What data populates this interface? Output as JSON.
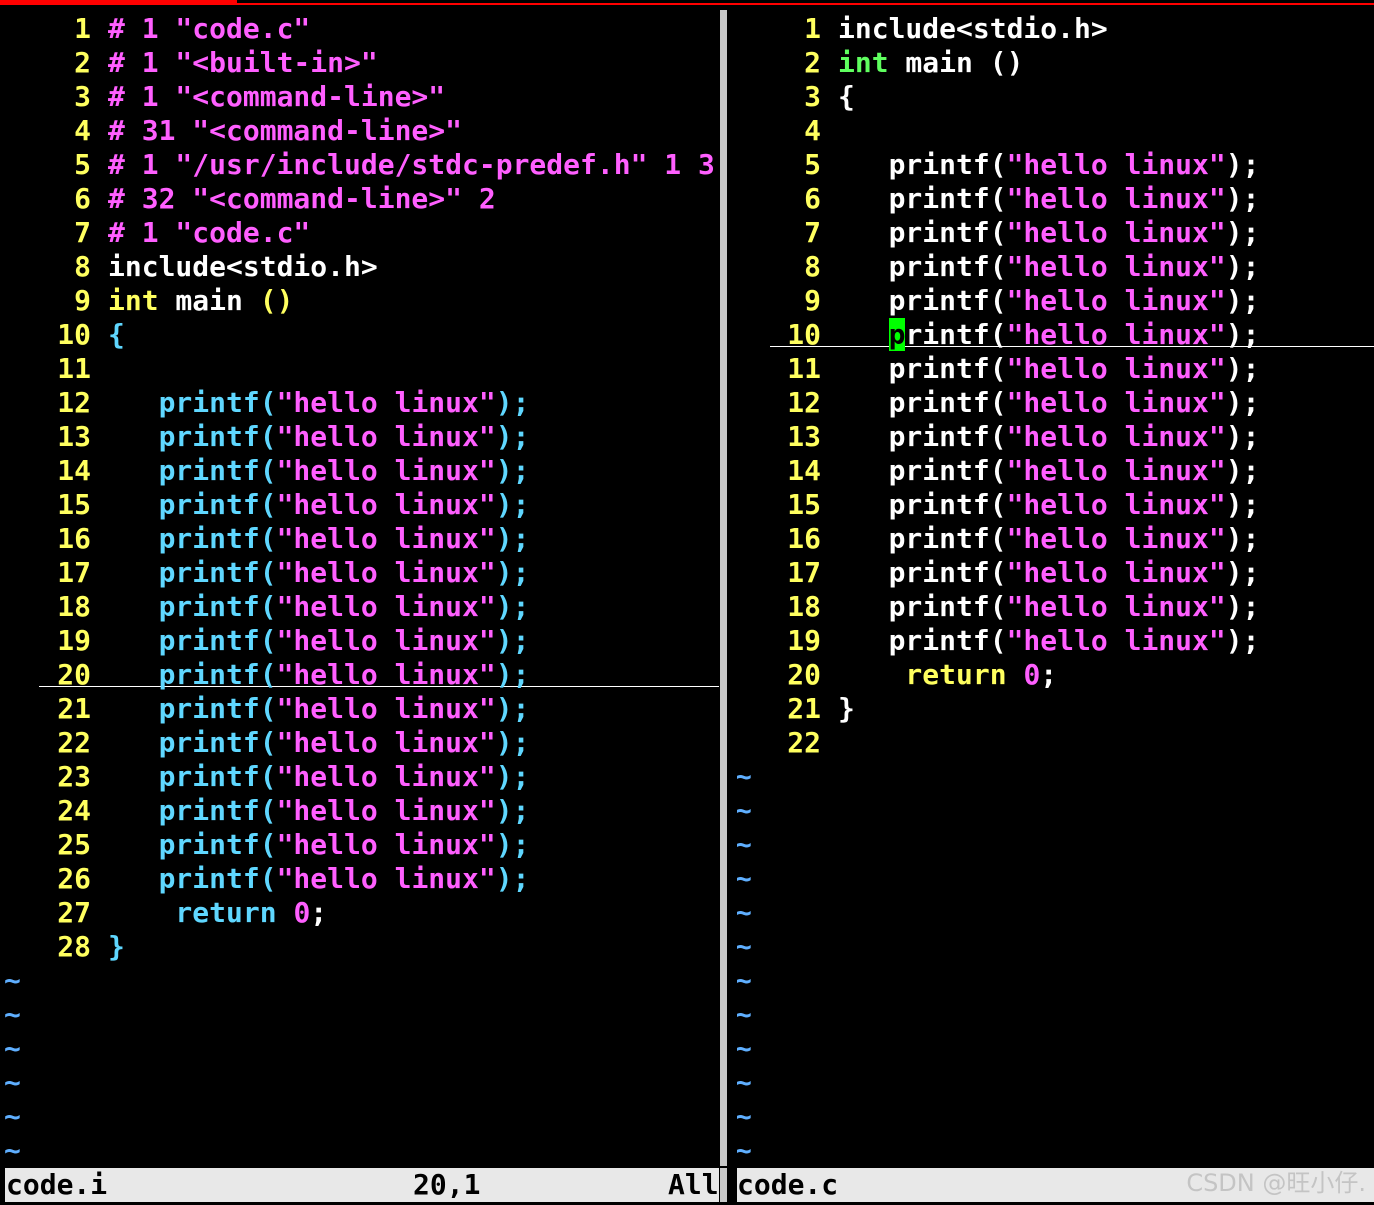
{
  "colors": {
    "background": "#000000",
    "line_number": "#ffff5f",
    "preproc": "#ff5fff",
    "string": "#ff5fff",
    "plain": "#ffffff",
    "left_code": "#5fd7ff",
    "left_keyword": "#ffff5f",
    "right_code": "#ffffff",
    "right_keyword": "#5fff5f",
    "return_right": "#ffff5f",
    "tilde": "#5fafff",
    "cursor": "#00ff00",
    "statusline": "#e8e8e8",
    "accent": "#ff0000"
  },
  "left_pane": {
    "lines": [
      {
        "num": "1",
        "segs": [
          [
            "# 1 \"code.c\"",
            "preproc"
          ]
        ]
      },
      {
        "num": "2",
        "segs": [
          [
            "# 1 \"<built-in>\"",
            "preproc"
          ]
        ]
      },
      {
        "num": "3",
        "segs": [
          [
            "# 1 \"<command-line>\"",
            "preproc"
          ]
        ]
      },
      {
        "num": "4",
        "segs": [
          [
            "# 31 \"<command-line>\"",
            "preproc"
          ]
        ]
      },
      {
        "num": "5",
        "segs": [
          [
            "# 1 \"/usr/include/stdc-predef.h\" 1 3",
            "preproc"
          ]
        ]
      },
      {
        "num": "6",
        "segs": [
          [
            "# 32 \"<command-line>\" 2",
            "preproc"
          ]
        ]
      },
      {
        "num": "7",
        "segs": [
          [
            "# 1 \"code.c\"",
            "preproc"
          ]
        ]
      },
      {
        "num": "8",
        "segs": [
          [
            "include<stdio.h>",
            "plain"
          ]
        ]
      },
      {
        "num": "9",
        "segs": [
          [
            "int",
            "left_keyword"
          ],
          [
            " main ",
            "plain"
          ],
          [
            "()",
            "left_keyword"
          ]
        ]
      },
      {
        "num": "10",
        "segs": [
          [
            "{",
            "left_code"
          ]
        ]
      },
      {
        "num": "11",
        "segs": []
      },
      {
        "num": "12",
        "segs": [
          [
            "   printf(",
            "left_code"
          ],
          [
            "\"hello linux\"",
            "string"
          ],
          [
            ");",
            "left_code"
          ]
        ]
      },
      {
        "num": "13",
        "segs": [
          [
            "   printf(",
            "left_code"
          ],
          [
            "\"hello linux\"",
            "string"
          ],
          [
            ");",
            "left_code"
          ]
        ]
      },
      {
        "num": "14",
        "segs": [
          [
            "   printf(",
            "left_code"
          ],
          [
            "\"hello linux\"",
            "string"
          ],
          [
            ");",
            "left_code"
          ]
        ]
      },
      {
        "num": "15",
        "segs": [
          [
            "   printf(",
            "left_code"
          ],
          [
            "\"hello linux\"",
            "string"
          ],
          [
            ");",
            "left_code"
          ]
        ]
      },
      {
        "num": "16",
        "segs": [
          [
            "   printf(",
            "left_code"
          ],
          [
            "\"hello linux\"",
            "string"
          ],
          [
            ");",
            "left_code"
          ]
        ]
      },
      {
        "num": "17",
        "segs": [
          [
            "   printf(",
            "left_code"
          ],
          [
            "\"hello linux\"",
            "string"
          ],
          [
            ");",
            "left_code"
          ]
        ]
      },
      {
        "num": "18",
        "segs": [
          [
            "   printf(",
            "left_code"
          ],
          [
            "\"hello linux\"",
            "string"
          ],
          [
            ");",
            "left_code"
          ]
        ]
      },
      {
        "num": "19",
        "segs": [
          [
            "   printf(",
            "left_code"
          ],
          [
            "\"hello linux\"",
            "string"
          ],
          [
            ");",
            "left_code"
          ]
        ]
      },
      {
        "num": "20",
        "segs": [
          [
            "   printf(",
            "left_code"
          ],
          [
            "\"hello linux\"",
            "string"
          ],
          [
            ");",
            "left_code"
          ]
        ]
      },
      {
        "num": "21",
        "segs": [
          [
            "   printf(",
            "left_code"
          ],
          [
            "\"hello linux\"",
            "string"
          ],
          [
            ");",
            "left_code"
          ]
        ]
      },
      {
        "num": "22",
        "segs": [
          [
            "   printf(",
            "left_code"
          ],
          [
            "\"hello linux\"",
            "string"
          ],
          [
            ");",
            "left_code"
          ]
        ]
      },
      {
        "num": "23",
        "segs": [
          [
            "   printf(",
            "left_code"
          ],
          [
            "\"hello linux\"",
            "string"
          ],
          [
            ");",
            "left_code"
          ]
        ]
      },
      {
        "num": "24",
        "segs": [
          [
            "   printf(",
            "left_code"
          ],
          [
            "\"hello linux\"",
            "string"
          ],
          [
            ");",
            "left_code"
          ]
        ]
      },
      {
        "num": "25",
        "segs": [
          [
            "   printf(",
            "left_code"
          ],
          [
            "\"hello linux\"",
            "string"
          ],
          [
            ");",
            "left_code"
          ]
        ]
      },
      {
        "num": "26",
        "segs": [
          [
            "   printf(",
            "left_code"
          ],
          [
            "\"hello linux\"",
            "string"
          ],
          [
            ");",
            "left_code"
          ]
        ]
      },
      {
        "num": "27",
        "segs": [
          [
            "    return ",
            "left_code"
          ],
          [
            "0",
            "string"
          ],
          [
            ";",
            "plain"
          ]
        ]
      },
      {
        "num": "28",
        "segs": [
          [
            "}",
            "left_code"
          ]
        ]
      }
    ],
    "tildes": [
      "~",
      "~",
      "~",
      "~",
      "~",
      "~"
    ]
  },
  "right_pane": {
    "lines": [
      {
        "num": "1",
        "segs": [
          [
            "include<stdio.h>",
            "plain"
          ]
        ]
      },
      {
        "num": "2",
        "segs": [
          [
            "int",
            "right_keyword"
          ],
          [
            " main ()",
            "plain"
          ]
        ]
      },
      {
        "num": "3",
        "segs": [
          [
            "{",
            "plain"
          ]
        ]
      },
      {
        "num": "4",
        "segs": []
      },
      {
        "num": "5",
        "segs": [
          [
            "   printf(",
            "right_code"
          ],
          [
            "\"hello linux\"",
            "string"
          ],
          [
            ");",
            "right_code"
          ]
        ]
      },
      {
        "num": "6",
        "segs": [
          [
            "   printf(",
            "right_code"
          ],
          [
            "\"hello linux\"",
            "string"
          ],
          [
            ");",
            "right_code"
          ]
        ]
      },
      {
        "num": "7",
        "segs": [
          [
            "   printf(",
            "right_code"
          ],
          [
            "\"hello linux\"",
            "string"
          ],
          [
            ");",
            "right_code"
          ]
        ]
      },
      {
        "num": "8",
        "segs": [
          [
            "   printf(",
            "right_code"
          ],
          [
            "\"hello linux\"",
            "string"
          ],
          [
            ");",
            "right_code"
          ]
        ]
      },
      {
        "num": "9",
        "segs": [
          [
            "   printf(",
            "right_code"
          ],
          [
            "\"hello linux\"",
            "string"
          ],
          [
            ");",
            "right_code"
          ]
        ]
      },
      {
        "num": "10",
        "segs": [
          [
            "   ",
            "right_code"
          ],
          [
            "p",
            "cursor"
          ],
          [
            "rintf(",
            "right_code"
          ],
          [
            "\"hello linux\"",
            "string"
          ],
          [
            ");",
            "right_code"
          ]
        ]
      },
      {
        "num": "11",
        "segs": [
          [
            "   printf(",
            "right_code"
          ],
          [
            "\"hello linux\"",
            "string"
          ],
          [
            ");",
            "right_code"
          ]
        ]
      },
      {
        "num": "12",
        "segs": [
          [
            "   printf(",
            "right_code"
          ],
          [
            "\"hello linux\"",
            "string"
          ],
          [
            ");",
            "right_code"
          ]
        ]
      },
      {
        "num": "13",
        "segs": [
          [
            "   printf(",
            "right_code"
          ],
          [
            "\"hello linux\"",
            "string"
          ],
          [
            ");",
            "right_code"
          ]
        ]
      },
      {
        "num": "14",
        "segs": [
          [
            "   printf(",
            "right_code"
          ],
          [
            "\"hello linux\"",
            "string"
          ],
          [
            ");",
            "right_code"
          ]
        ]
      },
      {
        "num": "15",
        "segs": [
          [
            "   printf(",
            "right_code"
          ],
          [
            "\"hello linux\"",
            "string"
          ],
          [
            ");",
            "right_code"
          ]
        ]
      },
      {
        "num": "16",
        "segs": [
          [
            "   printf(",
            "right_code"
          ],
          [
            "\"hello linux\"",
            "string"
          ],
          [
            ");",
            "right_code"
          ]
        ]
      },
      {
        "num": "17",
        "segs": [
          [
            "   printf(",
            "right_code"
          ],
          [
            "\"hello linux\"",
            "string"
          ],
          [
            ");",
            "right_code"
          ]
        ]
      },
      {
        "num": "18",
        "segs": [
          [
            "   printf(",
            "right_code"
          ],
          [
            "\"hello linux\"",
            "string"
          ],
          [
            ");",
            "right_code"
          ]
        ]
      },
      {
        "num": "19",
        "segs": [
          [
            "   printf(",
            "right_code"
          ],
          [
            "\"hello linux\"",
            "string"
          ],
          [
            ");",
            "right_code"
          ]
        ]
      },
      {
        "num": "20",
        "segs": [
          [
            "    return ",
            "return_right"
          ],
          [
            "0",
            "string"
          ],
          [
            ";",
            "plain"
          ]
        ]
      },
      {
        "num": "21",
        "segs": [
          [
            "}",
            "plain"
          ]
        ]
      },
      {
        "num": "22",
        "segs": []
      }
    ],
    "tildes": [
      "~",
      "~",
      "~",
      "~",
      "~",
      "~",
      "~",
      "~",
      "~",
      "~",
      "~",
      "~"
    ]
  },
  "status": {
    "left_filename": "code.i",
    "left_position": "20,1",
    "left_scroll": "All",
    "right_filename": "code.c"
  },
  "watermark": "CSDN @旺小仔."
}
